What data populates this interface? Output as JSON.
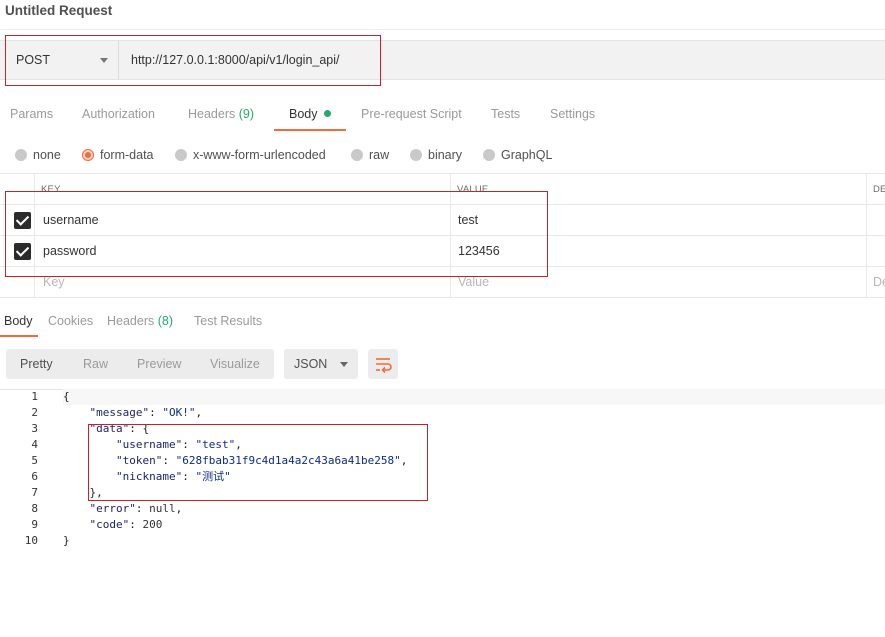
{
  "title": "Untitled Request",
  "request": {
    "method": "POST",
    "url": "http://127.0.0.1:8000/api/v1/login_api/"
  },
  "tabs": {
    "params": "Params",
    "authorization": "Authorization",
    "headers": "Headers",
    "headers_count": "(9)",
    "body": "Body",
    "prerequest": "Pre-request Script",
    "tests": "Tests",
    "settings": "Settings"
  },
  "body_types": {
    "none": "none",
    "form_data": "form-data",
    "urlencoded": "x-www-form-urlencoded",
    "raw": "raw",
    "binary": "binary",
    "graphql": "GraphQL",
    "selected": "form-data"
  },
  "params_table": {
    "key_header": "KEY",
    "value_header": "VALUE",
    "desc_header": "DE",
    "rows": [
      {
        "key": "username",
        "value": "test",
        "checked": true
      },
      {
        "key": "password",
        "value": "123456",
        "checked": true
      }
    ],
    "placeholder_key": "Key",
    "placeholder_value": "Value",
    "placeholder_desc": "De"
  },
  "response_tabs": {
    "body": "Body",
    "cookies": "Cookies",
    "headers": "Headers",
    "headers_count": "(8)",
    "test_results": "Test Results"
  },
  "view": {
    "pretty": "Pretty",
    "raw": "Raw",
    "preview": "Preview",
    "visualize": "Visualize",
    "format": "JSON"
  },
  "response": {
    "line_numbers": [
      "1",
      "2",
      "3",
      "4",
      "5",
      "6",
      "7",
      "8",
      "9",
      "10"
    ],
    "message_key": "\"message\"",
    "message_val": "\"OK!\"",
    "data_key": "\"data\"",
    "username_key": "\"username\"",
    "username_val": "\"test\"",
    "token_key": "\"token\"",
    "token_val": "\"628fbab31f9c4d1a4a2c43a6a41be258\"",
    "nickname_key": "\"nickname\"",
    "nickname_val": "\"测试\"",
    "error_key": "\"error\"",
    "error_val": "null",
    "code_key": "\"code\"",
    "code_val": "200"
  },
  "colors": {
    "accent": "#f26b3a",
    "success": "#27a96b",
    "annotation": "#c9212b"
  }
}
